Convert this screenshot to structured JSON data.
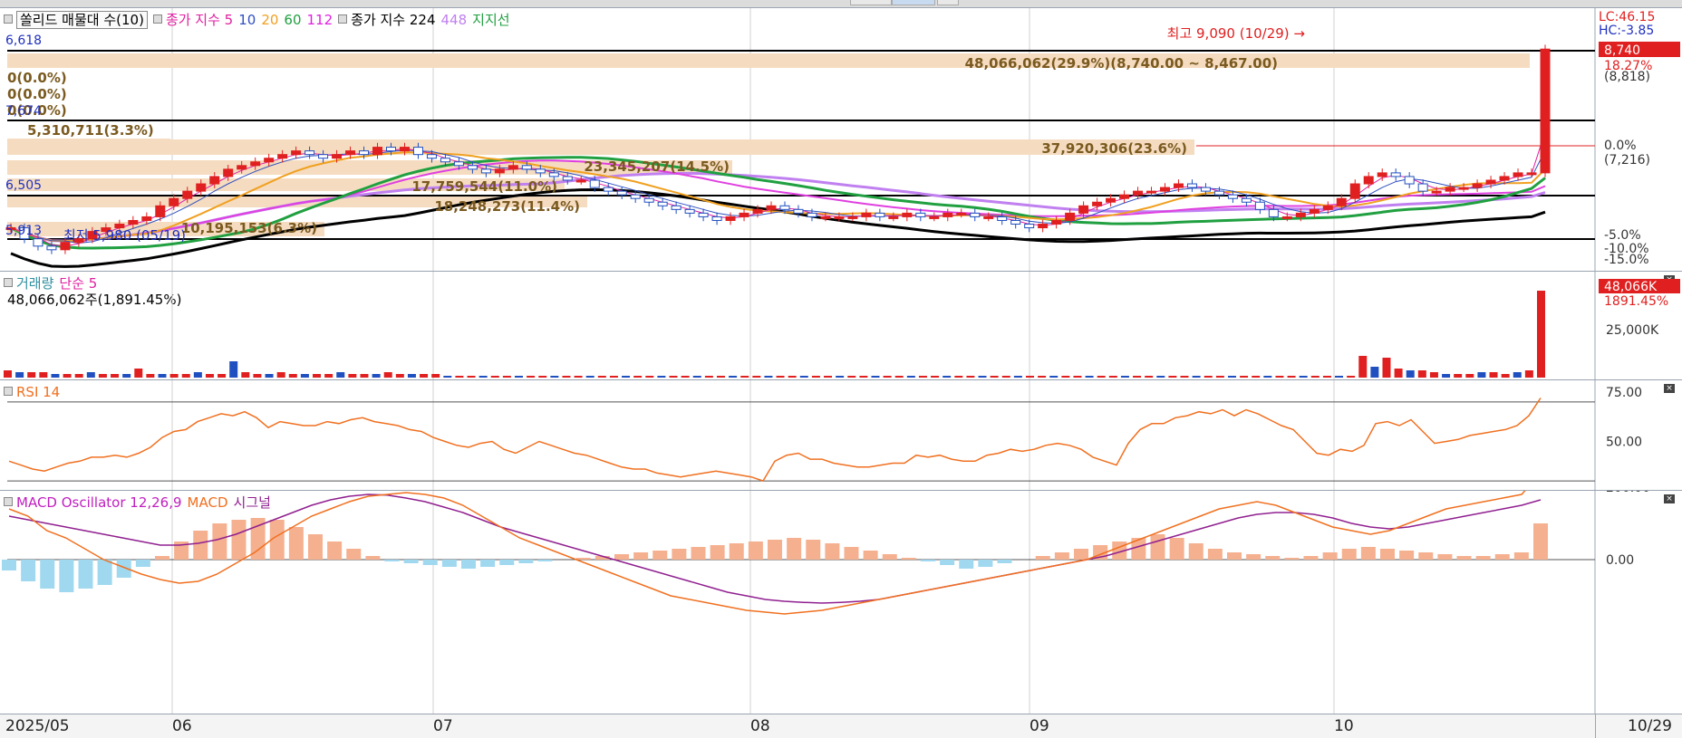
{
  "toolbar": {
    "legend_items": [
      "쏠리드 매물대 수(10)",
      "종가 지수 5",
      "10",
      "20",
      "60",
      "112",
      "종가 지수 224",
      "448",
      "지지선"
    ]
  },
  "colors": {
    "up": "#e02020",
    "down": "#2050c0",
    "ma5": "#e020a0",
    "ma10": "#3050c0",
    "ma20": "#f0a020",
    "ma60": "#20a040",
    "ma112": "#e040e0",
    "ma224": "#000000",
    "ma448": "#c080f0",
    "rsi": "#f07020",
    "macd": "#f07020",
    "signal": "#902090",
    "osc_pos": "#f5b090",
    "osc_neg": "#a0d8f0",
    "volume_profile": "#f5dcc0"
  },
  "price_panel": {
    "lc_label": "LC:46.15",
    "hc_label": "HC:-3.85",
    "high_marker": "최고 9,090 (10/29) →",
    "low_marker": "최저 5,980 (05/19)",
    "current_price": "8,740",
    "current_change": "18.27%",
    "right_labels": [
      "(8,818)",
      "0.0%",
      "(7,216)",
      "-5.0%",
      "-10.0%",
      "-15.0%"
    ],
    "left_labels": [
      "6,618",
      "7,674",
      "6,505",
      "5,913"
    ],
    "volume_profile": [
      {
        "label": "48,066,062(29.9%)(8,740.00 ~ 8,467.00)"
      },
      {
        "label": "0(0.0%)"
      },
      {
        "label": "0(0.0%)"
      },
      {
        "label": "0(0.0%)"
      },
      {
        "label": "5,310,711(3.3%)"
      },
      {
        "label": "37,920,306(23.6%)"
      },
      {
        "label": "23,345,207(14.5%)"
      },
      {
        "label": "17,759,544(11.0%)"
      },
      {
        "label": "18,248,273(11.4%)"
      },
      {
        "label": "10,195,153(6.3%)"
      }
    ]
  },
  "volume_panel": {
    "legend_title": "거래량",
    "legend_ma": "단순 5",
    "summary": "48,066,062주(1,891.45%)",
    "current_label": "48,066K",
    "pct_label": "1891.45%",
    "axis_label": "25,000K"
  },
  "rsi_panel": {
    "legend": "RSI 14",
    "axis_labels": [
      "75.00",
      "50.00"
    ]
  },
  "macd_panel": {
    "legend_osc": "MACD Oscillator 12,26,9",
    "legend_macd": "MACD",
    "legend_signal": "시그널",
    "axis_labels": [
      "200.00",
      "0.00"
    ]
  },
  "x_axis": {
    "labels": [
      "2025/05",
      "06",
      "07",
      "08",
      "09",
      "10",
      "10/29"
    ]
  },
  "chart_data": {
    "type": "candlestick",
    "title": "",
    "x_labels": [
      "2025/05",
      "06",
      "07",
      "08",
      "09",
      "10",
      "10/29"
    ],
    "ylim_price": [
      5800,
      9200
    ],
    "highest": {
      "value": 9090,
      "date": "10/29"
    },
    "lowest": {
      "value": 5980,
      "date": "05/19"
    },
    "close_trend": [
      6300,
      6150,
      6050,
      6000,
      6100,
      6150,
      6250,
      6300,
      6350,
      6400,
      6450,
      6600,
      6700,
      6800,
      6900,
      7000,
      7100,
      7150,
      7200,
      7250,
      7300,
      7350,
      7300,
      7250,
      7300,
      7350,
      7300,
      7400,
      7350,
      7400,
      7300,
      7250,
      7200,
      7150,
      7100,
      7050,
      7100,
      7150,
      7100,
      7050,
      7000,
      6950,
      6950,
      6850,
      6800,
      6750,
      6700,
      6650,
      6600,
      6550,
      6500,
      6450,
      6400,
      6450,
      6500,
      6550,
      6600,
      6550,
      6500,
      6450,
      6450,
      6450,
      6450,
      6500,
      6450,
      6450,
      6500,
      6450,
      6450,
      6500,
      6500,
      6450,
      6450,
      6400,
      6350,
      6300,
      6350,
      6400,
      6500,
      6600,
      6650,
      6700,
      6750,
      6800,
      6800,
      6850,
      6900,
      6850,
      6800,
      6750,
      6700,
      6650,
      6550,
      6450,
      6450,
      6500,
      6550,
      6600,
      6700,
      6900,
      7000,
      7050,
      7000,
      6900,
      6800,
      6800,
      6850,
      6850,
      6900,
      6950,
      7000,
      7050,
      7050,
      8740
    ],
    "volume": [
      4,
      3,
      3,
      3,
      2,
      2,
      2,
      3,
      2,
      2,
      2,
      5,
      2,
      2,
      2,
      2,
      3,
      2,
      2,
      9,
      3,
      2,
      2,
      3,
      2,
      2,
      2,
      2,
      3,
      2,
      2,
      2,
      3,
      2,
      2,
      2,
      2,
      1,
      1,
      1,
      1,
      1,
      1,
      1,
      1,
      1,
      1,
      1,
      1,
      1,
      1,
      1,
      1,
      1,
      1,
      1,
      1,
      1,
      1,
      1,
      1,
      1,
      1,
      1,
      1,
      1,
      1,
      1,
      1,
      1,
      1,
      1,
      1,
      1,
      1,
      1,
      1,
      1,
      1,
      1,
      1,
      1,
      1,
      1,
      1,
      1,
      1,
      1,
      1,
      1,
      1,
      1,
      1,
      1,
      1,
      1,
      1,
      1,
      1,
      1,
      1,
      1,
      1,
      1,
      1,
      1,
      1,
      1,
      1,
      1,
      1,
      1,
      1,
      1,
      12,
      6,
      11,
      5,
      4,
      4,
      3,
      2,
      2,
      2,
      3,
      3,
      2,
      3,
      4,
      48
    ],
    "rsi": [
      40,
      38,
      36,
      35,
      37,
      39,
      40,
      42,
      42,
      43,
      42,
      44,
      47,
      52,
      55,
      56,
      60,
      62,
      64,
      63,
      65,
      62,
      57,
      60,
      59,
      58,
      58,
      60,
      59,
      61,
      62,
      60,
      59,
      58,
      56,
      55,
      52,
      50,
      48,
      47,
      49,
      50,
      46,
      44,
      47,
      50,
      48,
      46,
      44,
      43,
      41,
      39,
      37,
      36,
      36,
      34,
      33,
      32,
      33,
      34,
      35,
      34,
      33,
      32,
      30,
      40,
      43,
      44,
      41,
      41,
      39,
      38,
      37,
      37,
      38,
      39,
      39,
      43,
      42,
      43,
      41,
      40,
      40,
      43,
      44,
      46,
      45,
      46,
      48,
      49,
      48,
      46,
      42,
      40,
      38,
      49,
      56,
      59,
      59,
      62,
      63,
      65,
      64,
      66,
      63,
      66,
      64,
      61,
      58,
      56,
      50,
      44,
      43,
      46,
      45,
      48,
      59,
      60,
      58,
      61,
      55,
      49,
      50,
      51,
      53,
      54,
      55,
      56,
      58,
      63,
      72
    ],
    "macd": [
      140,
      120,
      80,
      60,
      30,
      0,
      -20,
      -40,
      -55,
      -65,
      -60,
      -40,
      -10,
      20,
      60,
      90,
      120,
      140,
      160,
      175,
      180,
      185,
      180,
      170,
      150,
      120,
      90,
      60,
      40,
      20,
      0,
      -20,
      -40,
      -60,
      -80,
      -100,
      -110,
      -120,
      -130,
      -140,
      -145,
      -150,
      -145,
      -140,
      -130,
      -120,
      -110,
      -100,
      -90,
      -80,
      -70,
      -60,
      -50,
      -40,
      -30,
      -20,
      -10,
      0,
      20,
      40,
      60,
      80,
      100,
      120,
      140,
      150,
      160,
      150,
      130,
      110,
      90,
      80,
      70,
      80,
      100,
      120,
      140,
      150,
      160,
      170,
      180,
      240
    ],
    "signal": [
      120,
      110,
      100,
      90,
      80,
      70,
      60,
      50,
      40,
      40,
      45,
      55,
      70,
      90,
      110,
      130,
      150,
      165,
      175,
      180,
      178,
      170,
      160,
      145,
      130,
      110,
      90,
      75,
      60,
      45,
      30,
      15,
      0,
      -15,
      -30,
      -45,
      -60,
      -75,
      -90,
      -100,
      -110,
      -115,
      -118,
      -120,
      -118,
      -115,
      -110,
      -100,
      -90,
      -80,
      -70,
      -60,
      -50,
      -40,
      -30,
      -20,
      -10,
      0,
      10,
      25,
      40,
      55,
      70,
      85,
      100,
      115,
      125,
      130,
      130,
      125,
      115,
      100,
      90,
      85,
      90,
      100,
      110,
      120,
      130,
      140,
      150,
      165
    ],
    "osc": [
      -30,
      -60,
      -80,
      -90,
      -80,
      -70,
      -50,
      -20,
      10,
      50,
      80,
      100,
      110,
      115,
      110,
      90,
      70,
      50,
      30,
      10,
      -5,
      -10,
      -15,
      -20,
      -25,
      -20,
      -15,
      -10,
      -5,
      0,
      5,
      10,
      15,
      20,
      25,
      30,
      35,
      40,
      45,
      50,
      55,
      60,
      55,
      45,
      35,
      25,
      15,
      5,
      -5,
      -15,
      -25,
      -20,
      -10,
      0,
      10,
      20,
      30,
      40,
      50,
      60,
      70,
      60,
      45,
      30,
      20,
      15,
      10,
      5,
      10,
      20,
      30,
      35,
      30,
      25,
      20,
      15,
      10,
      10,
      15,
      20,
      100
    ]
  }
}
